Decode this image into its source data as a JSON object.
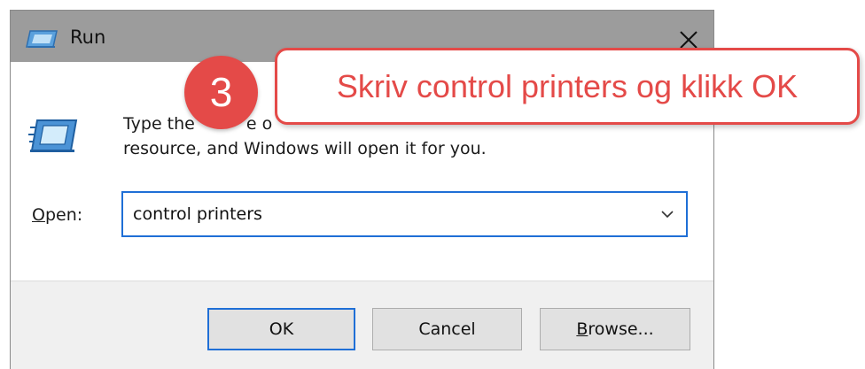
{
  "window": {
    "title": "Run",
    "close_symbol": "✕"
  },
  "dialog": {
    "description_line1_pre": "Type the",
    "description_line1_post": "e o",
    "description_line2": "resource, and Windows will open it for you.",
    "open_label_accel": "O",
    "open_label_rest": "pen:",
    "open_value": "control printers"
  },
  "buttons": {
    "ok_label": "OK",
    "cancel_label": "Cancel",
    "browse_accel": "B",
    "browse_rest": "rowse..."
  },
  "annotation": {
    "step_number": "3",
    "callout_text": "Skriv control printers og klikk OK",
    "accent_color": "#e44a48"
  },
  "colors": {
    "titlebar": "#9c9c9c",
    "focus_blue": "#1f6fd6",
    "footer": "#f0f0f0"
  },
  "icons": {
    "title_icon": "run-app-icon",
    "run_icon": "run-app-icon",
    "close_icon": "close-icon",
    "dropdown_icon": "chevron-down-icon"
  }
}
